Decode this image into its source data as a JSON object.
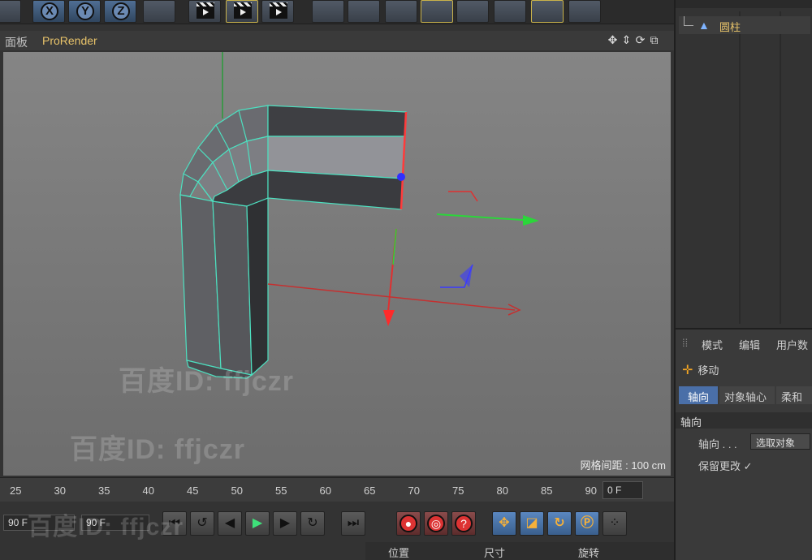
{
  "viewport": {
    "menu_label": "面板",
    "render_label": "ProRender",
    "grid_spacing": "网格间距 : 100 cm",
    "watermark_1": "百度ID: ffjczr",
    "watermark_2": "百度ID: ffjczr",
    "watermark_3": "百度ID: ffjczr"
  },
  "toolbar": {
    "axis_x": "X",
    "axis_y": "Y",
    "axis_z": "Z"
  },
  "timeline": {
    "ticks": [
      "25",
      "30",
      "35",
      "40",
      "45",
      "50",
      "55",
      "60",
      "65",
      "70",
      "75",
      "80",
      "85",
      "90"
    ],
    "current_frame": "0 F"
  },
  "playback": {
    "end_frame_1": "90 F",
    "end_frame_2": "90 F"
  },
  "coordinates": {
    "position": "位置",
    "size": "尺寸",
    "rotation": "旋转"
  },
  "object_manager": {
    "object_name": "圆柱"
  },
  "attributes": {
    "tab_mode": "模式",
    "tab_edit": "编辑",
    "tab_user": "用户数",
    "tool_name": "移动",
    "subtab_axis": "轴向",
    "subtab_object_axis": "对象轴心",
    "subtab_soft": "柔和",
    "section_axis": "轴向",
    "prop_axis": "轴向 . . .",
    "prop_axis_value": "选取对象",
    "prop_keep": "保留更改 ✓"
  },
  "colors": {
    "accent_label": "#e9c46a",
    "active_tab": "#4a6fa8",
    "wire": "#4de0c0"
  }
}
